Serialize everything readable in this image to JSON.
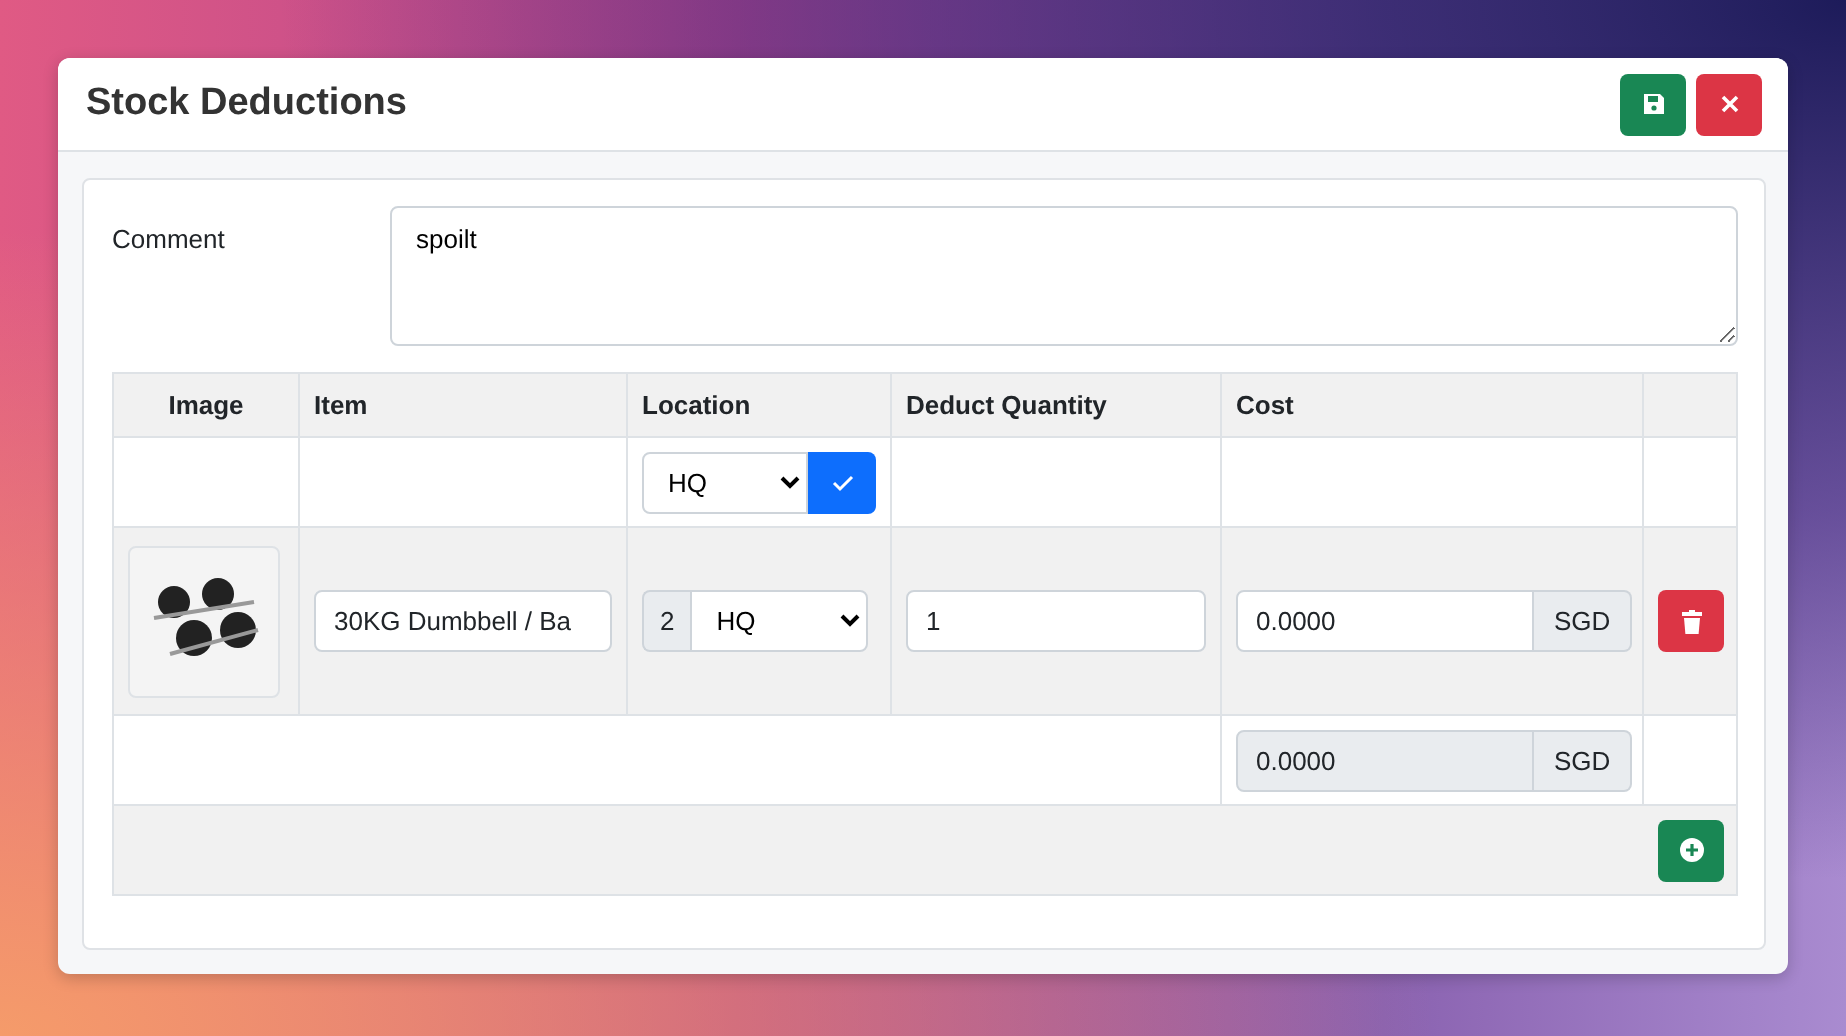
{
  "window": {
    "title": "Stock Deductions"
  },
  "comment": {
    "label": "Comment",
    "value": "spoilt"
  },
  "table": {
    "columns": [
      "Image",
      "Item",
      "Location",
      "Deduct Quantity",
      "Cost"
    ],
    "filter": {
      "location": "HQ"
    },
    "rows": [
      {
        "item": "30KG Dumbbell / Ba",
        "location_count": "2",
        "location": "HQ",
        "quantity": "1",
        "cost": "0.0000",
        "currency": "SGD"
      }
    ],
    "total": {
      "cost": "0.0000",
      "currency": "SGD"
    }
  }
}
